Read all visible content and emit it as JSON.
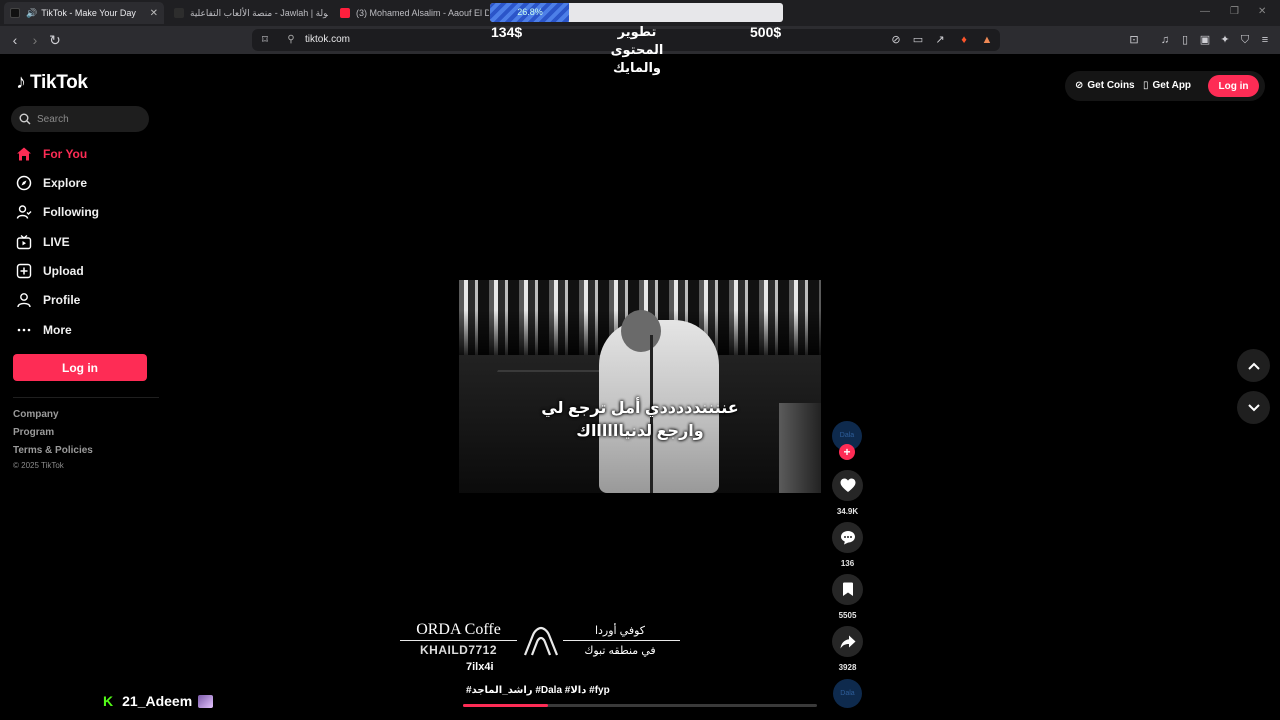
{
  "browser": {
    "tabs": [
      {
        "title": "TikTok - Make Your Day",
        "active": true,
        "icon": "tiktok-icon"
      },
      {
        "title": "منصة الألعاب التفاعلية - Jawlah | جولة",
        "active": false,
        "icon": "jawlah-icon"
      },
      {
        "title": "(3) Mohamed Alsalim - Aaouf El Dem",
        "active": false,
        "icon": "youtube-icon"
      }
    ],
    "url": "tiktok.com",
    "colors": {
      "tab_bg": "#1f1f22",
      "toolbar_bg": "#2c2c30"
    }
  },
  "overlay_goal": {
    "percent_label": "26.8%",
    "progress": 0.268,
    "current": "134$",
    "target": "500$",
    "title": "تطوير المحتوى والمايك"
  },
  "sidebar": {
    "brand": "TikTok",
    "search_placeholder": "Search",
    "items": [
      {
        "label": "For You",
        "icon": "home-icon",
        "active": true
      },
      {
        "label": "Explore",
        "icon": "compass-icon",
        "active": false
      },
      {
        "label": "Following",
        "icon": "following-icon",
        "active": false
      },
      {
        "label": "LIVE",
        "icon": "live-icon",
        "active": false
      },
      {
        "label": "Upload",
        "icon": "upload-icon",
        "active": false
      },
      {
        "label": "Profile",
        "icon": "profile-icon",
        "active": false
      },
      {
        "label": "More",
        "icon": "more-icon",
        "active": false
      }
    ],
    "login_label": "Log in",
    "footer_links": [
      "Company",
      "Program",
      "Terms & Policies"
    ],
    "copyright": "© 2025 TikTok"
  },
  "header": {
    "get_coins": "Get Coins",
    "get_app": "Get App",
    "login": "Log in"
  },
  "video": {
    "caption_line1": "عنننندددددي أمل ترجع لي",
    "caption_line2": "وارجع لدنيااااااك",
    "author": "7ilx4i",
    "description": "#راشد_الماجد #Dala #دالا #fyp",
    "overlay_brand_en": "ORDA Coffe",
    "overlay_brand_ar": "كوفي أوردا",
    "overlay_location_ar": "في منطقه تبوك",
    "overlay_handle": "KHAILD7712",
    "progress": 0.24
  },
  "actions": {
    "avatar_label": "Dala",
    "likes": "34.9K",
    "comments": "136",
    "saves": "5505",
    "shares": "3928",
    "disc_label": "Dala"
  },
  "stream_overlay": {
    "username": "21_Adeem",
    "platform_icon": "kick-icon"
  },
  "colors": {
    "accent": "#fe2c55",
    "background": "#000000",
    "kick_green": "#53fc18"
  }
}
